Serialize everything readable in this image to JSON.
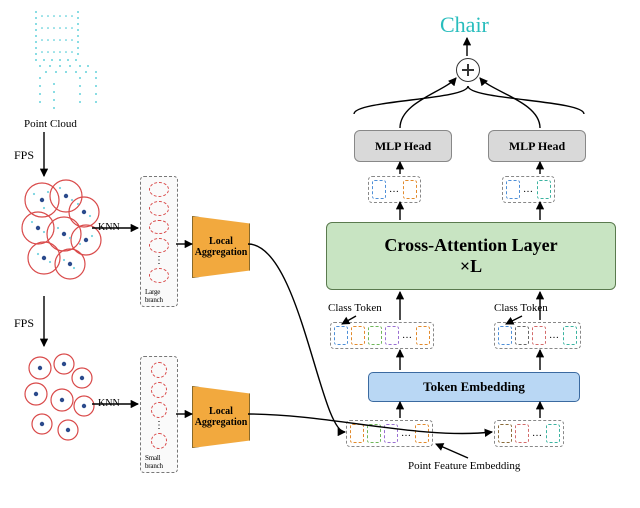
{
  "output": {
    "label": "Chair"
  },
  "mlp": {
    "label": "MLP Head"
  },
  "xattn": {
    "line1": "Cross-Attention Layer",
    "line2": "×L"
  },
  "token_embedding": {
    "label": "Token Embedding"
  },
  "class_token_label": "Class Token",
  "pfe_label": "Point Feature Embedding",
  "point_cloud_label": "Point Cloud",
  "fps_label": "FPS",
  "knn_label": "KNN",
  "local_agg": {
    "label": "Local\nAggregation"
  },
  "branch_labels": {
    "large": "Large branch",
    "small": "Small branch"
  }
}
